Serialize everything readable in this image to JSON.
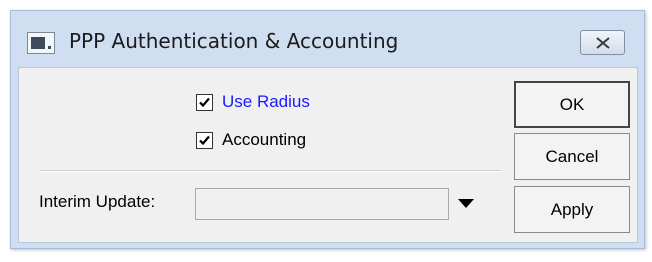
{
  "window": {
    "title": "PPP Authentication & Accounting"
  },
  "options": {
    "use_radius": {
      "label": "Use Radius",
      "checked": true,
      "color": "#1a1aff"
    },
    "accounting": {
      "label": "Accounting",
      "checked": true
    }
  },
  "interim_update": {
    "label": "Interim Update:",
    "value": ""
  },
  "buttons": {
    "ok": "OK",
    "cancel": "Cancel",
    "apply": "Apply"
  },
  "icons": {
    "app": "window-icon",
    "close": "close-icon",
    "dropdown": "triangle-down-icon",
    "check": "checkmark-icon"
  },
  "colors": {
    "titlebar": "#cfdef0",
    "content_bg": "#f0f0f0",
    "link_text": "#1a1aff"
  }
}
